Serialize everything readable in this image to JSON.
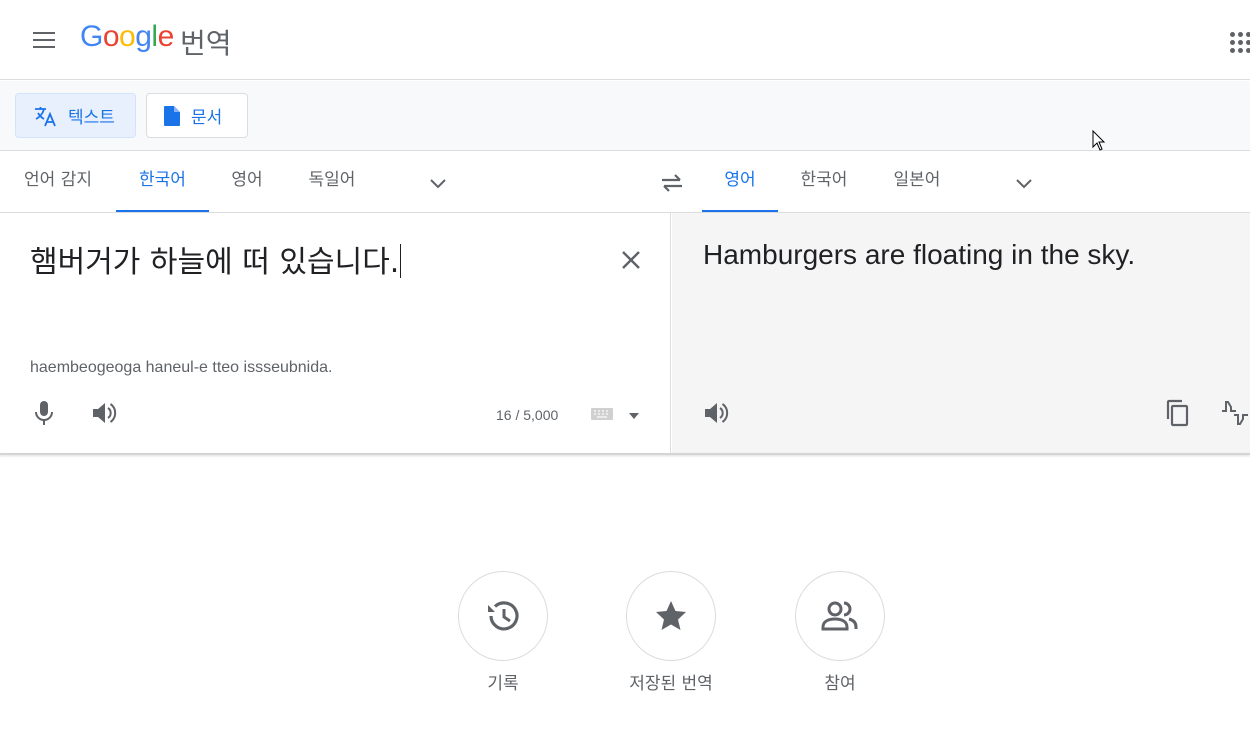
{
  "header": {
    "logo": [
      "G",
      "o",
      "o",
      "g",
      "l",
      "e"
    ],
    "product_name": "번역"
  },
  "modes": {
    "text_label": "텍스트",
    "document_label": "문서",
    "active": "text"
  },
  "source_languages": {
    "tabs": [
      "언어 감지",
      "한국어",
      "영어",
      "독일어"
    ],
    "selected": "한국어"
  },
  "target_languages": {
    "tabs": [
      "영어",
      "한국어",
      "일본어"
    ],
    "selected": "영어"
  },
  "source": {
    "text": "햄버거가 하늘에 떠 있습니다.",
    "romanization": "haembeogeoga haneul-e tteo issseubnida.",
    "char_count": "16 / 5,000"
  },
  "target": {
    "text": "Hamburgers are floating in the sky."
  },
  "shortcuts": [
    {
      "label": "기록",
      "icon": "history-icon"
    },
    {
      "label": "저장된 번역",
      "icon": "star-icon"
    },
    {
      "label": "참여",
      "icon": "people-icon"
    }
  ],
  "colors": {
    "accent": "#1a73e8",
    "text_primary": "#202124",
    "text_secondary": "#5f6368",
    "target_bg": "#f5f5f5"
  }
}
